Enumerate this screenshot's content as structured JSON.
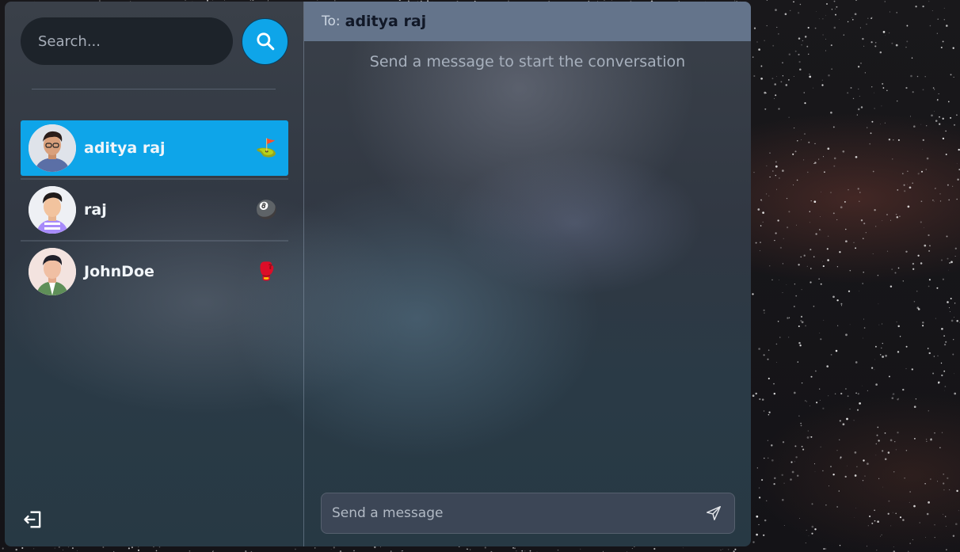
{
  "search": {
    "placeholder": "Search..."
  },
  "conversations": [
    {
      "name": "aditya raj",
      "emoji": "⛳",
      "selected": true
    },
    {
      "name": "raj",
      "emoji": "🎱",
      "selected": false
    },
    {
      "name": "JohnDoe",
      "emoji": "🥊",
      "selected": false
    }
  ],
  "chat": {
    "to_label": "To:",
    "to_name": "aditya raj",
    "empty_message": "Send a message to start the conversation",
    "composer_placeholder": "Send a message"
  },
  "colors": {
    "accent": "#0ea5e9",
    "header": "#64748b"
  },
  "icons": {
    "search": "search-icon",
    "logout": "logout-icon",
    "send": "send-icon"
  }
}
